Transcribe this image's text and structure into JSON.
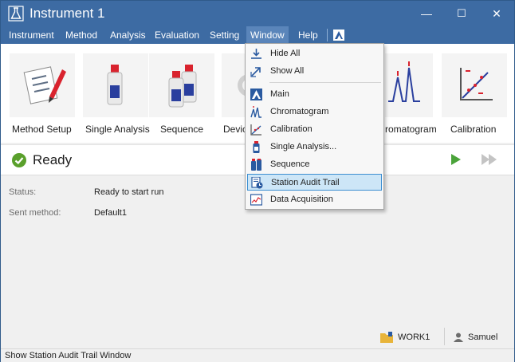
{
  "window": {
    "title": "Instrument 1",
    "controls": {
      "minimize": "—",
      "maximize": "☐",
      "close": "✕"
    }
  },
  "menubar": {
    "items": [
      "Instrument",
      "Method",
      "Analysis",
      "Evaluation",
      "Setting",
      "Window",
      "Help"
    ],
    "active": "Window"
  },
  "ribbon": {
    "tiles": [
      {
        "label": "Method Setup",
        "icon": "method-setup-icon"
      },
      {
        "label": "Single Analysis",
        "icon": "single-analysis-icon"
      },
      {
        "label": "Sequence",
        "icon": "sequence-icon"
      },
      {
        "label": "Devic",
        "icon": "device-icon"
      },
      {
        "label": "romatogram",
        "icon": "chromatogram-icon"
      },
      {
        "label": "Calibration",
        "icon": "calibration-icon"
      }
    ]
  },
  "run_status": {
    "state": "Ready",
    "play_icon": "play-icon",
    "fast_forward_icon": "fast-forward-icon"
  },
  "details": {
    "status_label": "Status:",
    "status_value": "Ready to start run",
    "sent_method_label": "Sent method:",
    "sent_method_value": "Default1"
  },
  "footer": {
    "workspace": "WORK1",
    "user": "Samuel"
  },
  "status_bar": {
    "text": "Show Station Audit Trail Window"
  },
  "window_menu": {
    "items": [
      {
        "label": "Hide All",
        "icon": "hide-all-icon"
      },
      {
        "label": "Show All",
        "icon": "show-all-icon"
      },
      {
        "label": "Main",
        "icon": "main-icon"
      },
      {
        "label": "Chromatogram",
        "icon": "chromatogram-icon"
      },
      {
        "label": "Calibration",
        "icon": "calibration-icon"
      },
      {
        "label": "Single Analysis...",
        "icon": "single-analysis-icon"
      },
      {
        "label": "Sequence",
        "icon": "sequence-icon"
      },
      {
        "label": "Station Audit Trail",
        "icon": "audit-trail-icon",
        "highlighted": true
      },
      {
        "label": "Data Acquisition",
        "icon": "data-acquisition-icon"
      }
    ]
  },
  "colors": {
    "titlebar": "#3d6ba3",
    "highlight": "#cde6f7",
    "ready_green": "#5aa02c",
    "play_green": "#4aa33a"
  }
}
